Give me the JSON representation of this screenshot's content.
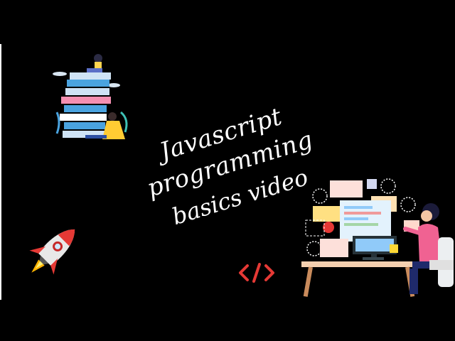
{
  "slide": {
    "title_line1": "Javascript programming",
    "title_line2": "basics video"
  },
  "icons": {
    "books": "books-reader-illustration",
    "rocket": "rocket-icon",
    "code": "code-tag-icon",
    "developer": "developer-at-desk-illustration"
  },
  "colors": {
    "background": "#000000",
    "title": "#ffffff",
    "code_tag": "#e53935",
    "rocket_body": "#e8e8e8",
    "rocket_accent": "#e53935",
    "shirt": "#f06292"
  }
}
